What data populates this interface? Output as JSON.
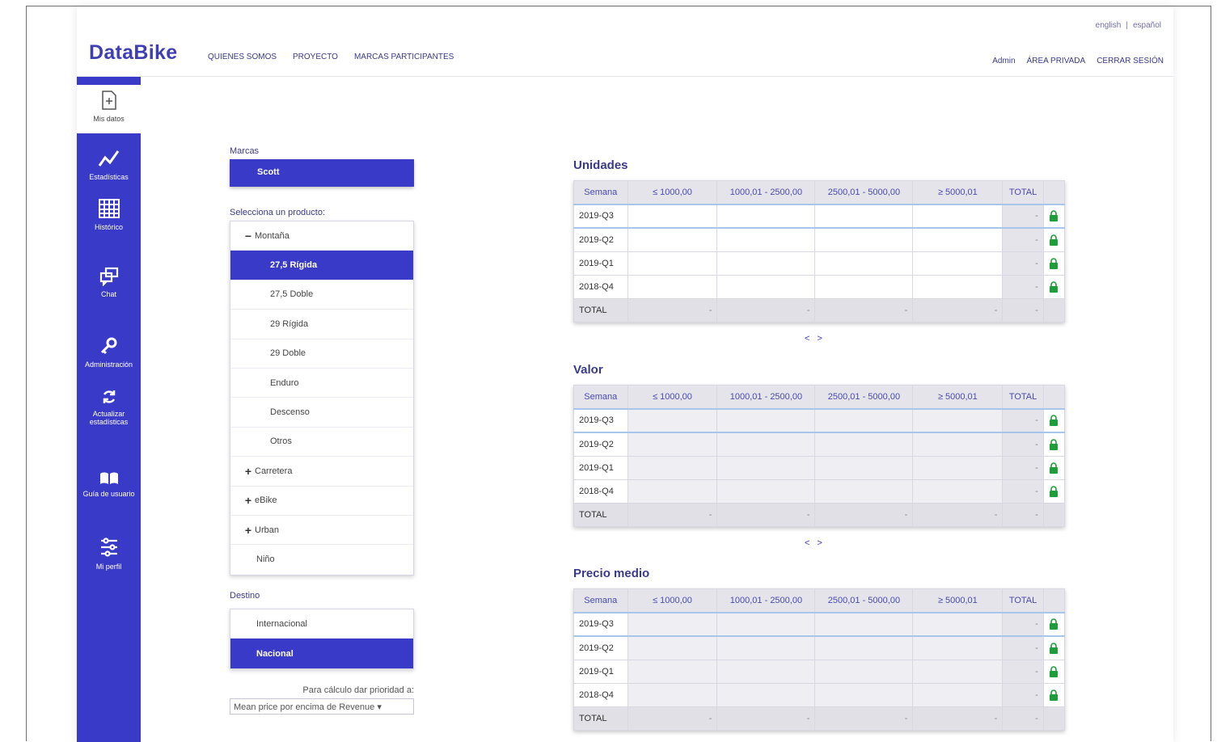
{
  "header": {
    "logo": "DataBike",
    "lang": [
      "english",
      "|",
      "español"
    ],
    "nav": [
      "QUIENES SOMOS",
      "PROYECTO",
      "MARCAS PARTICIPANTES"
    ],
    "user": "Admin",
    "private_area": "ÁREA PRIVADA",
    "logout": "CERRAR SESIÓN"
  },
  "sidebar": {
    "items": [
      {
        "label": "Mis datos",
        "icon": "document-plus-icon"
      },
      {
        "label": "Estadísticas",
        "icon": "line-chart-icon"
      },
      {
        "label": "Histórico",
        "icon": "calendar-grid-icon"
      },
      {
        "label": "Chat",
        "icon": "chat-icon"
      },
      {
        "label": "Administración",
        "icon": "key-icon"
      },
      {
        "label": "Actualizar",
        "label2": "estadísticas",
        "icon": "refresh-icon"
      },
      {
        "label": "Guía de usuario",
        "icon": "book-icon"
      },
      {
        "label": "Mi perfil",
        "icon": "sliders-icon"
      }
    ]
  },
  "filters": {
    "brand_label": "Marcas",
    "brand_selected": "Scott",
    "product_label": "Selecciona un producto:",
    "tree": [
      {
        "sym": "−",
        "label": "Montaña",
        "kind": "top"
      },
      {
        "label": "27,5 Rígida",
        "kind": "sub",
        "selected": true
      },
      {
        "label": "27,5 Doble",
        "kind": "sub"
      },
      {
        "label": "29 Rígida",
        "kind": "sub"
      },
      {
        "label": "29 Doble",
        "kind": "sub"
      },
      {
        "label": "Enduro",
        "kind": "sub"
      },
      {
        "label": "Descenso",
        "kind": "sub"
      },
      {
        "label": "Otros",
        "kind": "sub"
      },
      {
        "sym": "+",
        "label": "Carretera",
        "kind": "top"
      },
      {
        "sym": "+",
        "label": "eBike",
        "kind": "top"
      },
      {
        "sym": "+",
        "label": "Urban",
        "kind": "top"
      },
      {
        "label": "Niño",
        "kind": "plain"
      }
    ],
    "destino_label": "Destino",
    "destino": [
      {
        "label": "Internacional",
        "selected": false
      },
      {
        "label": "Nacional",
        "selected": true
      }
    ],
    "priority_label": "Para cálculo dar prioridad a:",
    "priority_value": "Mean price por encima de Revenue ▾"
  },
  "tables": {
    "headers": [
      "Semana",
      "≤ 1000,00",
      "1000,01 - 2500,00",
      "2500,01 - 5000,00",
      "≥ 5000,01",
      "TOTAL"
    ],
    "rows": [
      "2019-Q3",
      "2019-Q2",
      "2019-Q1",
      "2018-Q4"
    ],
    "total_label": "TOTAL",
    "dash": "-",
    "pager": "< >",
    "sections": [
      {
        "title": "Unidades",
        "editable": true
      },
      {
        "title": "Valor",
        "editable": false
      },
      {
        "title": "Precio medio",
        "editable": false
      }
    ]
  },
  "colors": {
    "accent": "#3a3ac8",
    "lock": "#1f9d3a"
  }
}
